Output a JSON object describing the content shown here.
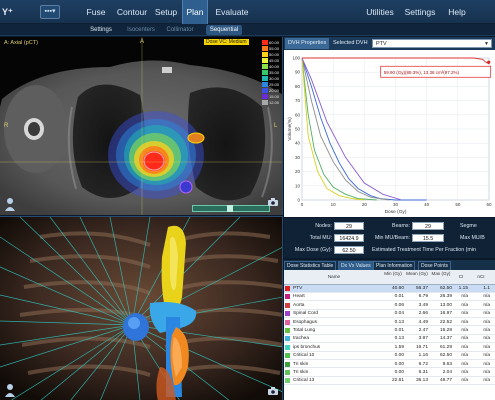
{
  "logo": "Y⁺",
  "nav": {
    "menu_glyph": "▪▪▪▾",
    "items": [
      {
        "label": "Fuse"
      },
      {
        "label": "Contour"
      },
      {
        "label": "Setup"
      },
      {
        "label": "Plan"
      },
      {
        "label": "Evaluate"
      }
    ],
    "right_items": [
      {
        "label": "Utilities"
      },
      {
        "label": "Settings"
      },
      {
        "label": "Help"
      }
    ]
  },
  "subtabs": [
    {
      "label": "Settings"
    },
    {
      "label": "Isocenters"
    },
    {
      "label": "Collimator"
    },
    {
      "label": "Sequential"
    }
  ],
  "ct_view": {
    "title": "A: Axial (pCT)",
    "tag": "Dose VC: Medium",
    "orient": {
      "top": "A",
      "left": "R",
      "right": "L"
    },
    "dose_legend": [
      {
        "value": "60.00",
        "color": "#ff2a1a"
      },
      {
        "value": "55.00",
        "color": "#ff7a1a"
      },
      {
        "value": "50.00",
        "color": "#ffd21a"
      },
      {
        "value": "45.00",
        "color": "#e8f23a"
      },
      {
        "value": "40.00",
        "color": "#8be04a"
      },
      {
        "value": "35.00",
        "color": "#34c86b"
      },
      {
        "value": "30.00",
        "color": "#1fb7b0"
      },
      {
        "value": "25.00",
        "color": "#2a86e0"
      },
      {
        "value": "20.00",
        "color": "#3b4fe0"
      },
      {
        "value": "15.00",
        "color": "#6a2ad8"
      },
      {
        "value": "12.00",
        "color": "#a8a8a8"
      }
    ]
  },
  "dvh": {
    "tab_properties": "DVH Properties",
    "tab_selected": "Selected DVH",
    "select_value": "PTV",
    "ylabel": "Volume(%)",
    "xlabel": "Dose (Gy)",
    "annotation": "59.90 (Gy)(89.3%), 13.36 cm³(97.2%)"
  },
  "chart_data": {
    "type": "line",
    "xlabel": "Dose (Gy)",
    "ylabel": "Volume(%)",
    "xlim": [
      0,
      60
    ],
    "ylim": [
      0,
      100
    ],
    "xticks": [
      0,
      10,
      20,
      30,
      40,
      50,
      60
    ],
    "yticks": [
      0,
      10,
      20,
      30,
      40,
      50,
      60,
      70,
      80,
      90,
      100
    ],
    "series": [
      {
        "color": "#e03030",
        "x": [
          0,
          55,
          58,
          59,
          60
        ],
        "y": [
          100,
          100,
          99,
          97,
          96
        ]
      },
      {
        "color": "#3a6ad8",
        "x": [
          0,
          3,
          6,
          9,
          12,
          15,
          18,
          22,
          25,
          30,
          40
        ],
        "y": [
          100,
          80,
          58,
          40,
          26,
          15,
          8,
          3,
          1,
          0,
          0
        ]
      },
      {
        "color": "#8c8c8c",
        "x": [
          0,
          3,
          6,
          10,
          14,
          18,
          22,
          28
        ],
        "y": [
          100,
          70,
          45,
          27,
          14,
          6,
          2,
          0
        ]
      },
      {
        "color": "#50b060",
        "x": [
          0,
          2,
          4,
          7,
          10,
          14,
          18,
          24
        ],
        "y": [
          100,
          60,
          35,
          18,
          9,
          4,
          1,
          0
        ]
      },
      {
        "color": "#d8d020",
        "x": [
          0,
          2,
          5,
          8,
          12,
          16,
          20
        ],
        "y": [
          100,
          45,
          20,
          8,
          3,
          1,
          0
        ]
      },
      {
        "color": "#8a5ad0",
        "x": [
          0,
          3,
          8,
          14,
          20,
          26,
          32
        ],
        "y": [
          100,
          85,
          55,
          30,
          12,
          4,
          0
        ]
      }
    ]
  },
  "stats": {
    "nodes_label": "Nodes:",
    "nodes_value": "29",
    "beams_label": "Beams:",
    "beams_value": "29",
    "segments_label": "Segme",
    "total_mu_label": "Total MU:",
    "total_mu_value": "16424.9",
    "min_mu_label": "Min MU/Beam:",
    "min_mu_value": "15.5",
    "max_mu_label": "Max MU/B",
    "max_dose_label": "Max Dose (Gy):",
    "max_dose_value": "62.50",
    "est_time_label": "Estimated Treatment Time Per Fraction (min"
  },
  "table": {
    "tabs": [
      {
        "label": "Dose Statistics Table"
      },
      {
        "label": "Dx Vx Values"
      },
      {
        "label": "Plan Information"
      },
      {
        "label": "Dose Points"
      }
    ],
    "headers": [
      {
        "label": "Name"
      },
      {
        "label": "Min (Gy)"
      },
      {
        "label": "Mean (Gy)"
      },
      {
        "label": "Max (Gy)"
      },
      {
        "label": "CI"
      },
      {
        "label": "nCI"
      }
    ],
    "rows": [
      {
        "name": "PTV",
        "color": "#e02020",
        "min": "40.60",
        "mean": "56.37",
        "max": "62.50",
        "ci": "1.15",
        "nci": "1.1"
      },
      {
        "name": "Heart",
        "color": "#c02080",
        "min": "0.01",
        "mean": "6.79",
        "max": "26.39",
        "ci": "n/a",
        "nci": "n/a"
      },
      {
        "name": "Aorta",
        "color": "#d04040",
        "min": "0.06",
        "mean": "3.49",
        "max": "13.00",
        "ci": "n/a",
        "nci": "n/a"
      },
      {
        "name": "Spinal Cord",
        "color": "#a040d0",
        "min": "0.04",
        "mean": "2.66",
        "max": "16.97",
        "ci": "n/a",
        "nci": "n/a"
      },
      {
        "name": "Esophagus",
        "color": "#e060a0",
        "min": "0.13",
        "mean": "4.49",
        "max": "22.52",
        "ci": "n/a",
        "nci": "n/a"
      },
      {
        "name": "Total Lung",
        "color": "#60c040",
        "min": "0.01",
        "mean": "2.47",
        "max": "15.28",
        "ci": "n/a",
        "nci": "n/a"
      },
      {
        "name": "trachea",
        "color": "#40b0e0",
        "min": "0.13",
        "mean": "3.97",
        "max": "14.37",
        "ci": "n/a",
        "nci": "n/a"
      },
      {
        "name": "ips bronchus",
        "color": "#40d0c0",
        "min": "1.59",
        "mean": "16.71",
        "max": "61.29",
        "ci": "n/a",
        "nci": "n/a"
      },
      {
        "name": "Critical 10",
        "color": "#50c050",
        "min": "0.00",
        "mean": "1.16",
        "max": "62.50",
        "ci": "n/a",
        "nci": "n/a"
      },
      {
        "name": "Tri skin",
        "color": "#40a040",
        "min": "0.00",
        "mean": "6.72",
        "max": "9.63",
        "ci": "n/a",
        "nci": "n/a"
      },
      {
        "name": "Tri skin",
        "color": "#60c060",
        "min": "0.00",
        "mean": "6.31",
        "max": "2.04",
        "ci": "n/a",
        "nci": "n/a"
      },
      {
        "name": "Critical 13",
        "color": "#70d070",
        "min": "22.61",
        "mean": "36.13",
        "max": "48.77",
        "ci": "n/a",
        "nci": "n/a"
      }
    ]
  }
}
